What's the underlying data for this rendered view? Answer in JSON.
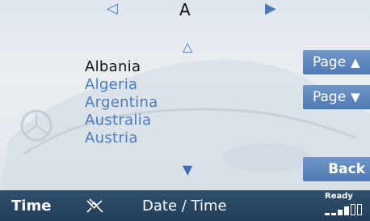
{
  "header": {
    "prev_icon": "triangle-left-outline-icon",
    "letter": "A",
    "next_icon": "triangle-right-filled-icon"
  },
  "list": {
    "scroll_up_icon": "triangle-up-outline-icon",
    "scroll_down_icon": "triangle-down-filled-icon",
    "items": [
      "Albania",
      "Algeria",
      "Argentina",
      "Australia",
      "Austria"
    ],
    "selected_index": 0
  },
  "side_buttons": {
    "page_up_label": "Page",
    "page_up_icon": "triangle-up-icon",
    "page_down_label": "Page",
    "page_down_icon": "triangle-down-icon",
    "back_label": "Back"
  },
  "status_bar": {
    "time_label": "Time",
    "satellite_icon": "satellite-icon",
    "date_time_label": "Date / Time",
    "status_text": "Ready",
    "signal_icon": "signal-strength-icon"
  },
  "colors": {
    "accent": "#4a7cc0",
    "button": "#5a84ba",
    "status_bar": "#263f5a"
  }
}
